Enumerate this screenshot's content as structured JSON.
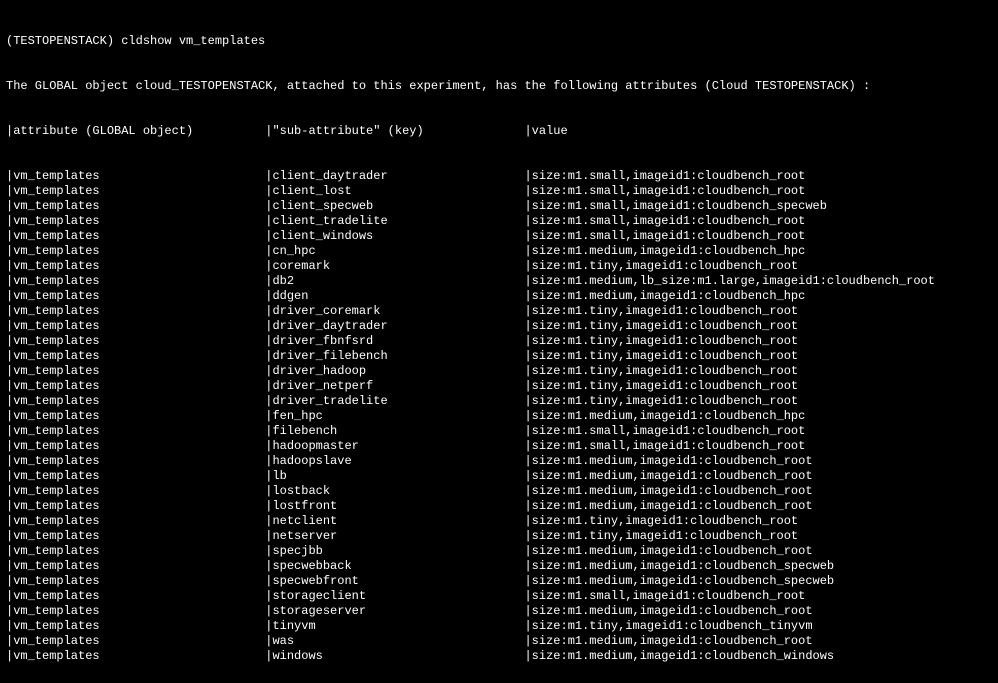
{
  "prompt": {
    "prefix": "(TESTOPENSTACK) ",
    "command": "cldshow vm_templates"
  },
  "intro": "The GLOBAL object cloud_TESTOPENSTACK, attached to this experiment, has the following attributes (Cloud TESTOPENSTACK) :",
  "columns": {
    "attr_width": 35,
    "sub_width": 35,
    "attr_header": "attribute (GLOBAL object)",
    "sub_header": "\"sub-attribute\" (key)",
    "val_header": "value"
  },
  "rows": [
    {
      "attr": "vm_templates",
      "sub": "client_daytrader",
      "val": "size:m1.small,imageid1:cloudbench_root"
    },
    {
      "attr": "vm_templates",
      "sub": "client_lost",
      "val": "size:m1.small,imageid1:cloudbench_root"
    },
    {
      "attr": "vm_templates",
      "sub": "client_specweb",
      "val": "size:m1.small,imageid1:cloudbench_specweb"
    },
    {
      "attr": "vm_templates",
      "sub": "client_tradelite",
      "val": "size:m1.small,imageid1:cloudbench_root"
    },
    {
      "attr": "vm_templates",
      "sub": "client_windows",
      "val": "size:m1.small,imageid1:cloudbench_root"
    },
    {
      "attr": "vm_templates",
      "sub": "cn_hpc",
      "val": "size:m1.medium,imageid1:cloudbench_hpc"
    },
    {
      "attr": "vm_templates",
      "sub": "coremark",
      "val": "size:m1.tiny,imageid1:cloudbench_root"
    },
    {
      "attr": "vm_templates",
      "sub": "db2",
      "val": "size:m1.medium,lb_size:m1.large,imageid1:cloudbench_root"
    },
    {
      "attr": "vm_templates",
      "sub": "ddgen",
      "val": "size:m1.medium,imageid1:cloudbench_hpc"
    },
    {
      "attr": "vm_templates",
      "sub": "driver_coremark",
      "val": "size:m1.tiny,imageid1:cloudbench_root"
    },
    {
      "attr": "vm_templates",
      "sub": "driver_daytrader",
      "val": "size:m1.tiny,imageid1:cloudbench_root"
    },
    {
      "attr": "vm_templates",
      "sub": "driver_fbnfsrd",
      "val": "size:m1.tiny,imageid1:cloudbench_root"
    },
    {
      "attr": "vm_templates",
      "sub": "driver_filebench",
      "val": "size:m1.tiny,imageid1:cloudbench_root"
    },
    {
      "attr": "vm_templates",
      "sub": "driver_hadoop",
      "val": "size:m1.tiny,imageid1:cloudbench_root"
    },
    {
      "attr": "vm_templates",
      "sub": "driver_netperf",
      "val": "size:m1.tiny,imageid1:cloudbench_root"
    },
    {
      "attr": "vm_templates",
      "sub": "driver_tradelite",
      "val": "size:m1.tiny,imageid1:cloudbench_root"
    },
    {
      "attr": "vm_templates",
      "sub": "fen_hpc",
      "val": "size:m1.medium,imageid1:cloudbench_hpc"
    },
    {
      "attr": "vm_templates",
      "sub": "filebench",
      "val": "size:m1.small,imageid1:cloudbench_root"
    },
    {
      "attr": "vm_templates",
      "sub": "hadoopmaster",
      "val": "size:m1.small,imageid1:cloudbench_root"
    },
    {
      "attr": "vm_templates",
      "sub": "hadoopslave",
      "val": "size:m1.medium,imageid1:cloudbench_root"
    },
    {
      "attr": "vm_templates",
      "sub": "lb",
      "val": "size:m1.medium,imageid1:cloudbench_root"
    },
    {
      "attr": "vm_templates",
      "sub": "lostback",
      "val": "size:m1.medium,imageid1:cloudbench_root"
    },
    {
      "attr": "vm_templates",
      "sub": "lostfront",
      "val": "size:m1.medium,imageid1:cloudbench_root"
    },
    {
      "attr": "vm_templates",
      "sub": "netclient",
      "val": "size:m1.tiny,imageid1:cloudbench_root"
    },
    {
      "attr": "vm_templates",
      "sub": "netserver",
      "val": "size:m1.tiny,imageid1:cloudbench_root"
    },
    {
      "attr": "vm_templates",
      "sub": "specjbb",
      "val": "size:m1.medium,imageid1:cloudbench_root"
    },
    {
      "attr": "vm_templates",
      "sub": "specwebback",
      "val": "size:m1.medium,imageid1:cloudbench_specweb"
    },
    {
      "attr": "vm_templates",
      "sub": "specwebfront",
      "val": "size:m1.medium,imageid1:cloudbench_specweb"
    },
    {
      "attr": "vm_templates",
      "sub": "storageclient",
      "val": "size:m1.small,imageid1:cloudbench_root"
    },
    {
      "attr": "vm_templates",
      "sub": "storageserver",
      "val": "size:m1.medium,imageid1:cloudbench_root"
    },
    {
      "attr": "vm_templates",
      "sub": "tinyvm",
      "val": "size:m1.tiny,imageid1:cloudbench_tinyvm"
    },
    {
      "attr": "vm_templates",
      "sub": "was",
      "val": "size:m1.medium,imageid1:cloudbench_root"
    },
    {
      "attr": "vm_templates",
      "sub": "windows",
      "val": "size:m1.medium,imageid1:cloudbench_windows"
    }
  ]
}
